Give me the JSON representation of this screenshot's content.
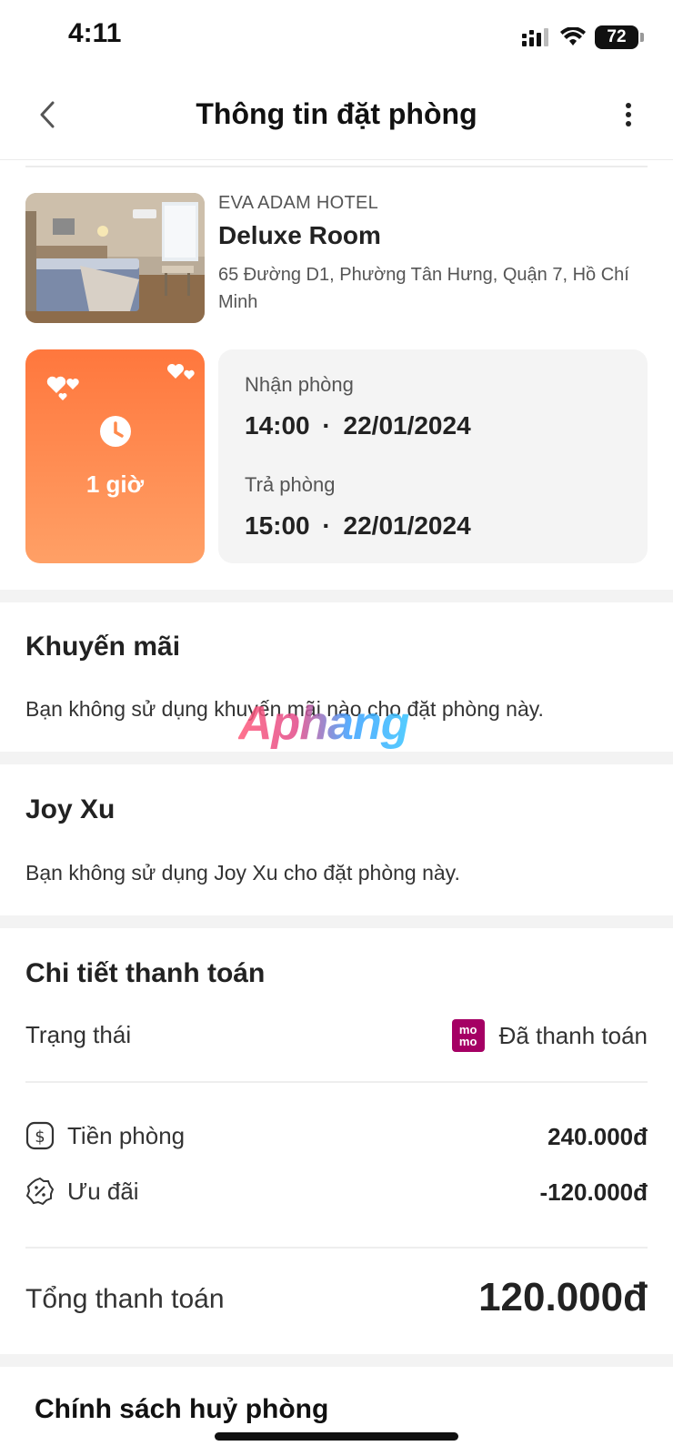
{
  "status_bar": {
    "time": "4:11",
    "battery": "72"
  },
  "nav": {
    "title": "Thông tin đặt phòng",
    "back_icon": "chevron-left-icon",
    "more_icon": "more-vertical-icon"
  },
  "hotel": {
    "brand": "EVA ADAM HOTEL",
    "room": "Deluxe Room",
    "address": "65 Đường D1, Phường Tân Hưng, Quận 7, Hồ Chí Minh"
  },
  "booking": {
    "duration": "1 giờ",
    "checkin_label": "Nhận phòng",
    "checkin_time": "14:00",
    "checkin_date": "22/01/2024",
    "checkout_label": "Trả phòng",
    "checkout_time": "15:00",
    "checkout_date": "22/01/2024",
    "separator": "·"
  },
  "promo": {
    "title": "Khuyến mãi",
    "text": "Bạn không sử dụng khuyến mãi nào cho đặt phòng này."
  },
  "watermark": "Aphang",
  "joyxu": {
    "title": "Joy Xu",
    "text": "Bạn không sử dụng Joy Xu cho đặt phòng này."
  },
  "payment": {
    "title": "Chi tiết thanh toán",
    "status_label": "Trạng thái",
    "status_value": "Đã thanh toán",
    "momo_text": "mo mo",
    "room_price_label": "Tiền phòng",
    "room_price_value": "240.000đ",
    "discount_label": "Ưu đãi",
    "discount_value": "-120.000đ",
    "total_label": "Tổng thanh toán",
    "total_value": "120.000đ"
  },
  "policy": {
    "title": "Chính sách huỷ phòng"
  },
  "colors": {
    "accent_orange": "#ff773d",
    "momo": "#a50064"
  }
}
